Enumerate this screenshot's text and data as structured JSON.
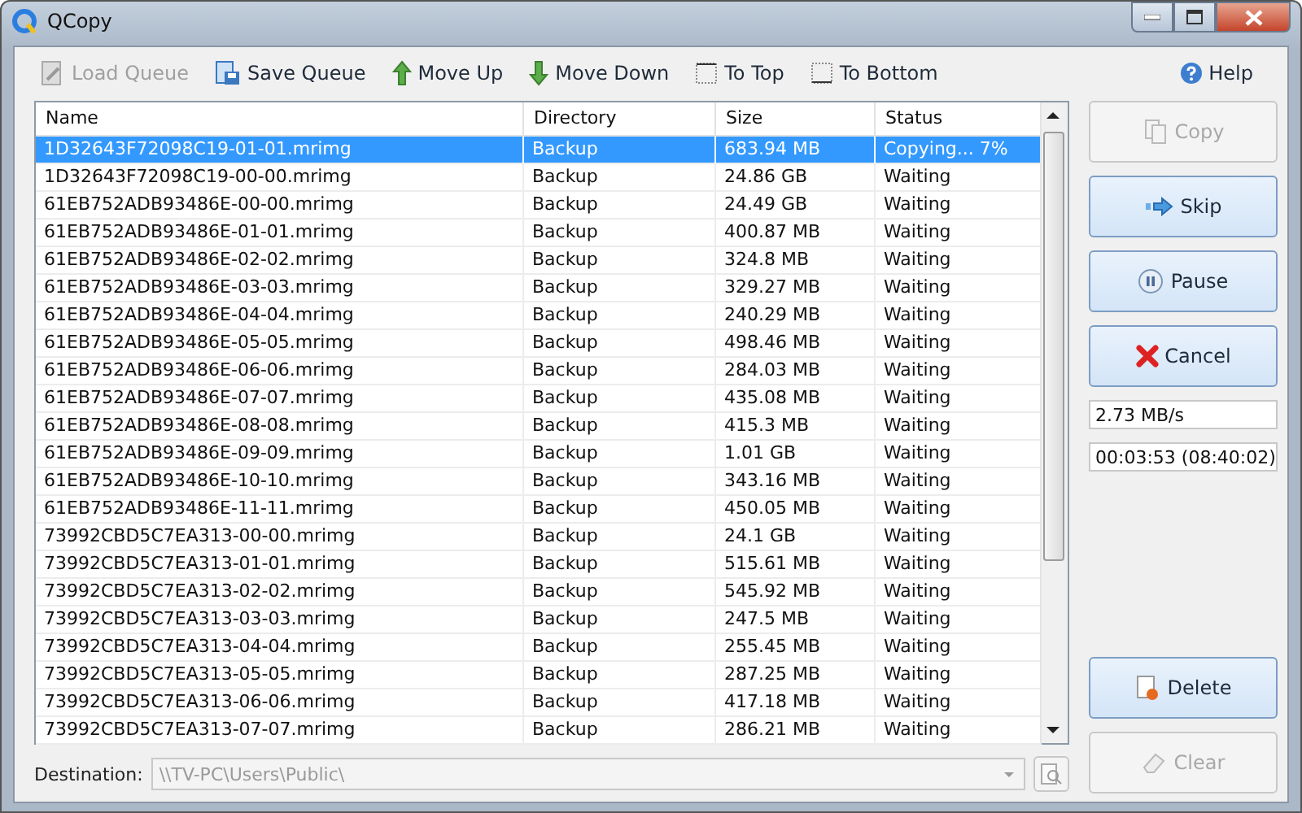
{
  "window": {
    "title": "QCopy"
  },
  "toolbar": [
    {
      "kind": "load",
      "label": "Load Queue",
      "disabled": true
    },
    {
      "kind": "save",
      "label": "Save Queue",
      "disabled": false
    },
    {
      "kind": "up",
      "label": "Move Up",
      "disabled": false
    },
    {
      "kind": "down",
      "label": "Move Down",
      "disabled": false
    },
    {
      "kind": "top",
      "label": "To Top",
      "disabled": false
    },
    {
      "kind": "bottom",
      "label": "To Bottom",
      "disabled": false
    }
  ],
  "help": {
    "label": "Help"
  },
  "table": {
    "columns": [
      "Name",
      "Directory",
      "Size",
      "Status"
    ],
    "rows": [
      {
        "name": "1D32643F72098C19-01-01.mrimg",
        "directory": "Backup",
        "size": "683.94 MB",
        "status": "Copying... 7%",
        "selected": true
      },
      {
        "name": "1D32643F72098C19-00-00.mrimg",
        "directory": "Backup",
        "size": "24.86 GB",
        "status": "Waiting",
        "selected": false
      },
      {
        "name": "61EB752ADB93486E-00-00.mrimg",
        "directory": "Backup",
        "size": "24.49 GB",
        "status": "Waiting",
        "selected": false
      },
      {
        "name": "61EB752ADB93486E-01-01.mrimg",
        "directory": "Backup",
        "size": "400.87 MB",
        "status": "Waiting",
        "selected": false
      },
      {
        "name": "61EB752ADB93486E-02-02.mrimg",
        "directory": "Backup",
        "size": "324.8 MB",
        "status": "Waiting",
        "selected": false
      },
      {
        "name": "61EB752ADB93486E-03-03.mrimg",
        "directory": "Backup",
        "size": "329.27 MB",
        "status": "Waiting",
        "selected": false
      },
      {
        "name": "61EB752ADB93486E-04-04.mrimg",
        "directory": "Backup",
        "size": "240.29 MB",
        "status": "Waiting",
        "selected": false
      },
      {
        "name": "61EB752ADB93486E-05-05.mrimg",
        "directory": "Backup",
        "size": "498.46 MB",
        "status": "Waiting",
        "selected": false
      },
      {
        "name": "61EB752ADB93486E-06-06.mrimg",
        "directory": "Backup",
        "size": "284.03 MB",
        "status": "Waiting",
        "selected": false
      },
      {
        "name": "61EB752ADB93486E-07-07.mrimg",
        "directory": "Backup",
        "size": "435.08 MB",
        "status": "Waiting",
        "selected": false
      },
      {
        "name": "61EB752ADB93486E-08-08.mrimg",
        "directory": "Backup",
        "size": "415.3 MB",
        "status": "Waiting",
        "selected": false
      },
      {
        "name": "61EB752ADB93486E-09-09.mrimg",
        "directory": "Backup",
        "size": "1.01 GB",
        "status": "Waiting",
        "selected": false
      },
      {
        "name": "61EB752ADB93486E-10-10.mrimg",
        "directory": "Backup",
        "size": "343.16 MB",
        "status": "Waiting",
        "selected": false
      },
      {
        "name": "61EB752ADB93486E-11-11.mrimg",
        "directory": "Backup",
        "size": "450.05 MB",
        "status": "Waiting",
        "selected": false
      },
      {
        "name": "73992CBD5C7EA313-00-00.mrimg",
        "directory": "Backup",
        "size": "24.1 GB",
        "status": "Waiting",
        "selected": false
      },
      {
        "name": "73992CBD5C7EA313-01-01.mrimg",
        "directory": "Backup",
        "size": "515.61 MB",
        "status": "Waiting",
        "selected": false
      },
      {
        "name": "73992CBD5C7EA313-02-02.mrimg",
        "directory": "Backup",
        "size": "545.92 MB",
        "status": "Waiting",
        "selected": false
      },
      {
        "name": "73992CBD5C7EA313-03-03.mrimg",
        "directory": "Backup",
        "size": "247.5 MB",
        "status": "Waiting",
        "selected": false
      },
      {
        "name": "73992CBD5C7EA313-04-04.mrimg",
        "directory": "Backup",
        "size": "255.45 MB",
        "status": "Waiting",
        "selected": false
      },
      {
        "name": "73992CBD5C7EA313-05-05.mrimg",
        "directory": "Backup",
        "size": "287.25 MB",
        "status": "Waiting",
        "selected": false
      },
      {
        "name": "73992CBD5C7EA313-06-06.mrimg",
        "directory": "Backup",
        "size": "417.18 MB",
        "status": "Waiting",
        "selected": false
      },
      {
        "name": "73992CBD5C7EA313-07-07.mrimg",
        "directory": "Backup",
        "size": "286.21 MB",
        "status": "Waiting",
        "selected": false
      }
    ]
  },
  "actions": [
    {
      "kind": "copy",
      "label": "Copy",
      "disabled": true
    },
    {
      "kind": "skip",
      "label": "Skip",
      "disabled": false
    },
    {
      "kind": "pause",
      "label": "Pause",
      "disabled": false
    },
    {
      "kind": "cancel",
      "label": "Cancel",
      "disabled": false
    }
  ],
  "speed": "2.73 MB/s",
  "elapsed": "00:03:53 (08:40:02)",
  "bottom_actions": [
    {
      "kind": "delete",
      "label": "Delete",
      "disabled": false
    },
    {
      "kind": "clear",
      "label": "Clear",
      "disabled": true
    }
  ],
  "destination": {
    "label": "Destination:",
    "value": "\\\\TV-PC\\Users\\Public\\",
    "disabled": true
  }
}
